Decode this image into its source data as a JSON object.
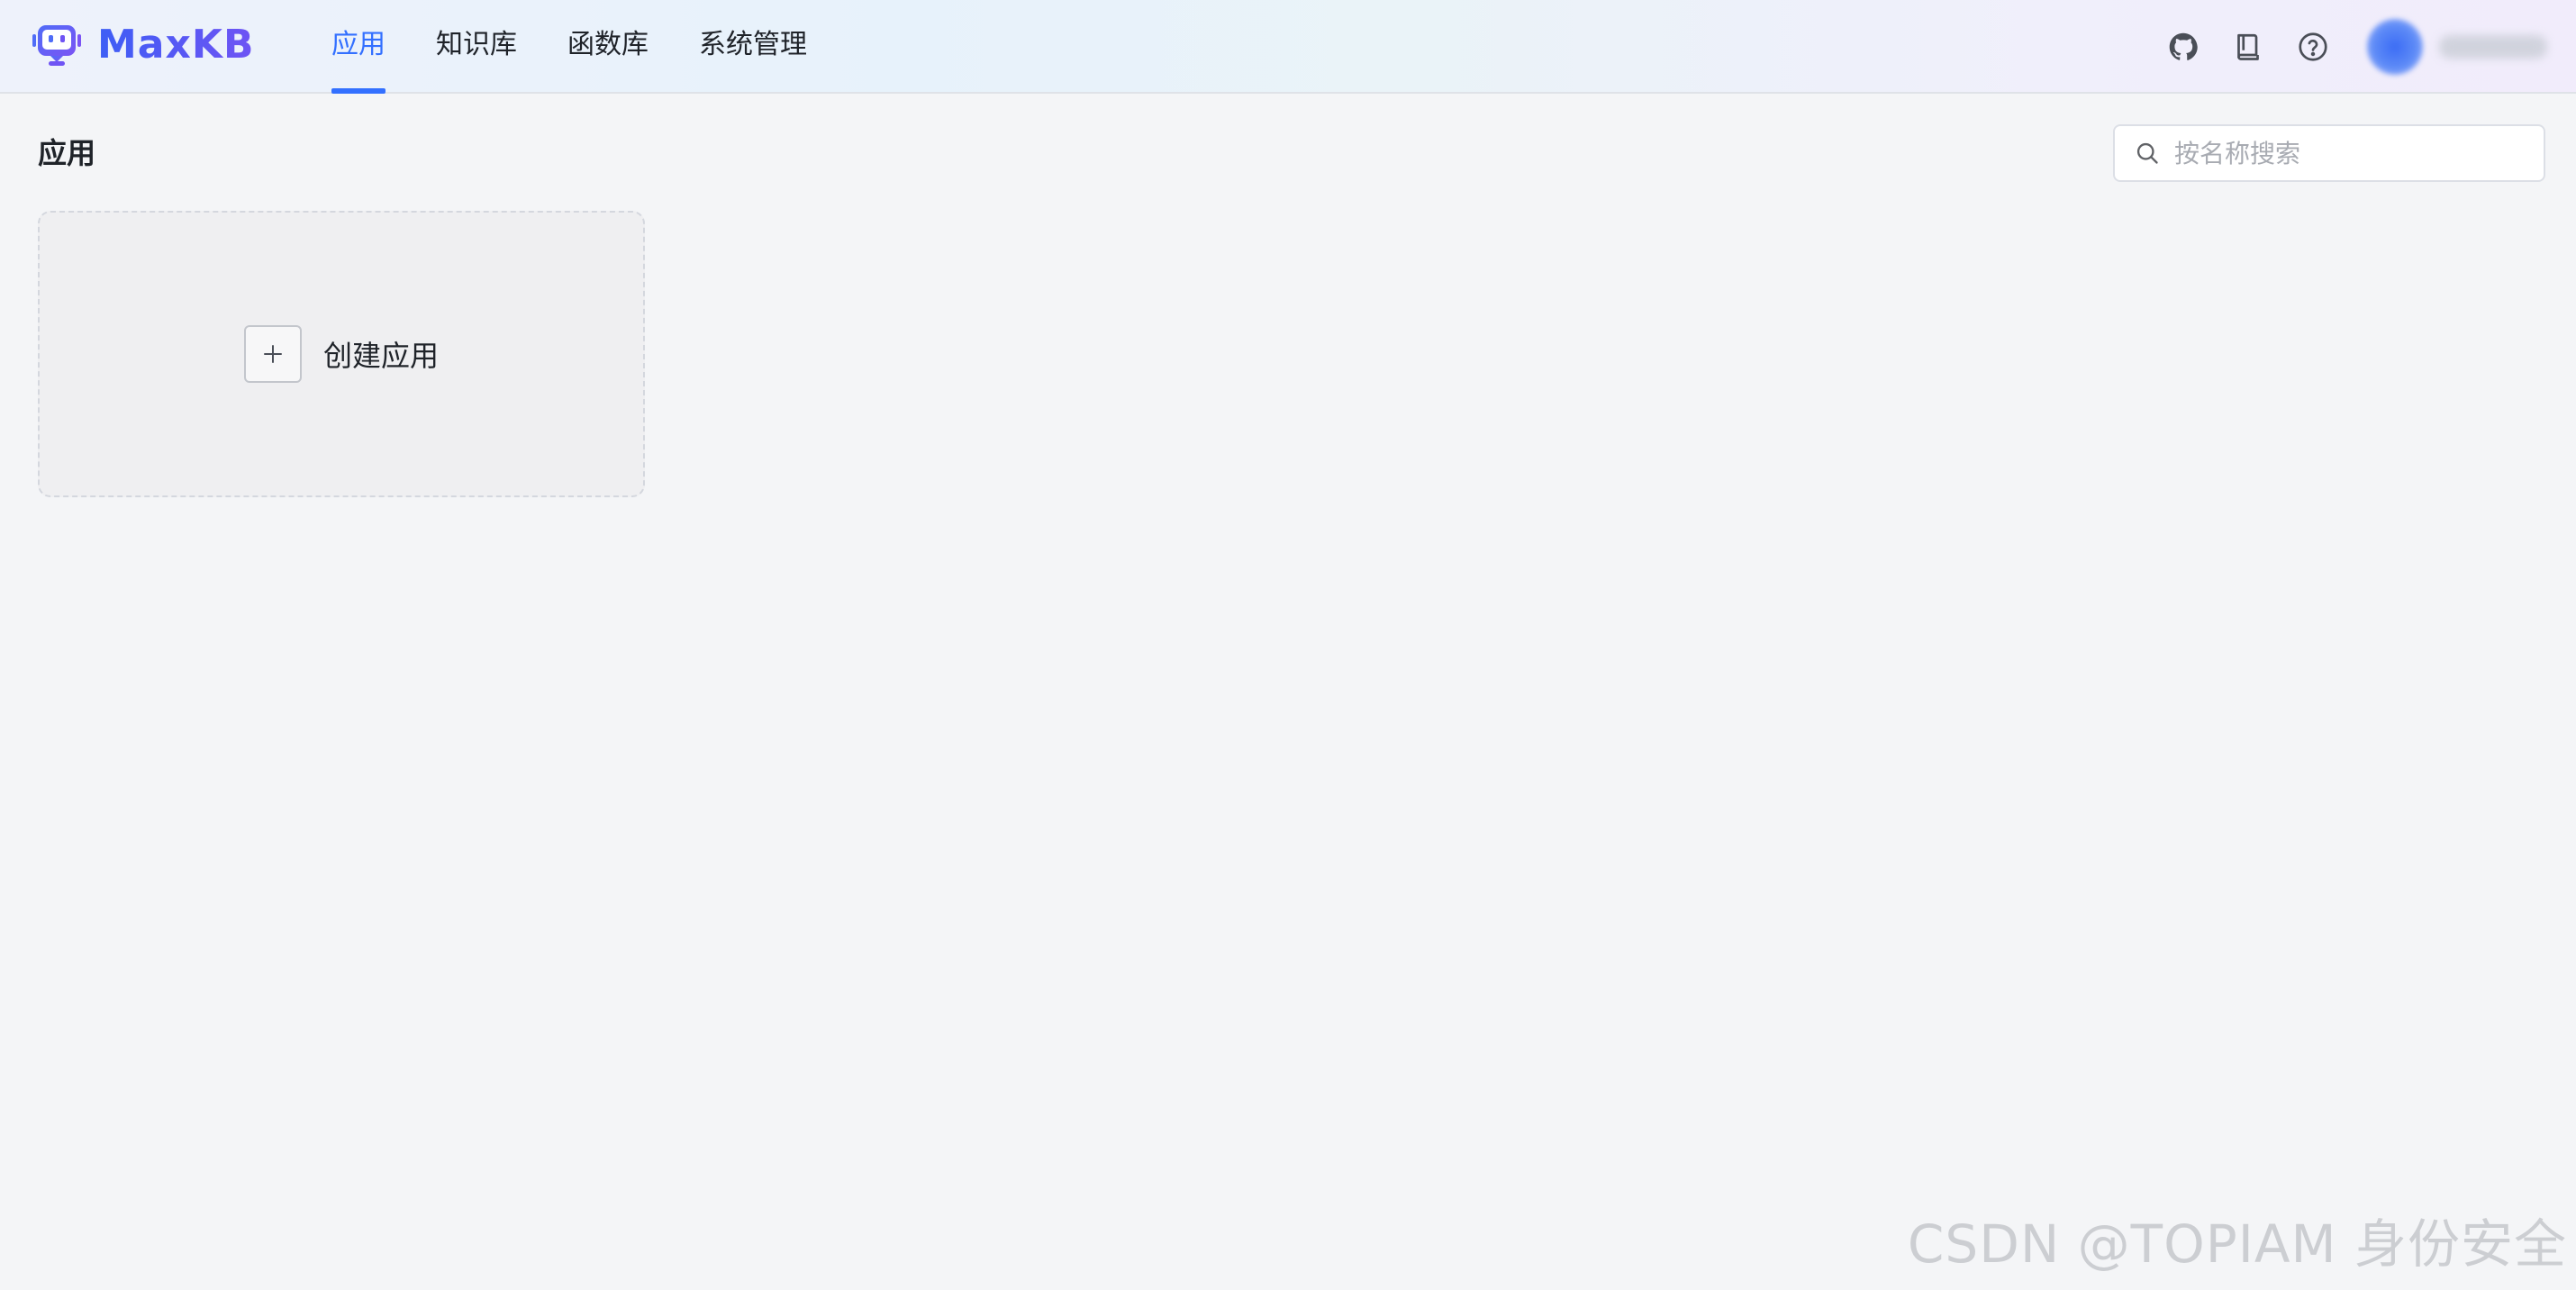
{
  "header": {
    "logo_text": "MaxKB",
    "nav": [
      {
        "label": "应用",
        "active": true
      },
      {
        "label": "知识库",
        "active": false
      },
      {
        "label": "函数库",
        "active": false
      },
      {
        "label": "系统管理",
        "active": false
      }
    ],
    "icons": [
      "github-icon",
      "book-icon",
      "help-icon"
    ]
  },
  "page": {
    "title": "应用"
  },
  "search": {
    "placeholder": "按名称搜索"
  },
  "create_card": {
    "label": "创建应用"
  },
  "watermark": "CSDN @TOPIAM 身份安全",
  "colors": {
    "accent": "#3370ff",
    "background": "#f4f5f7"
  }
}
